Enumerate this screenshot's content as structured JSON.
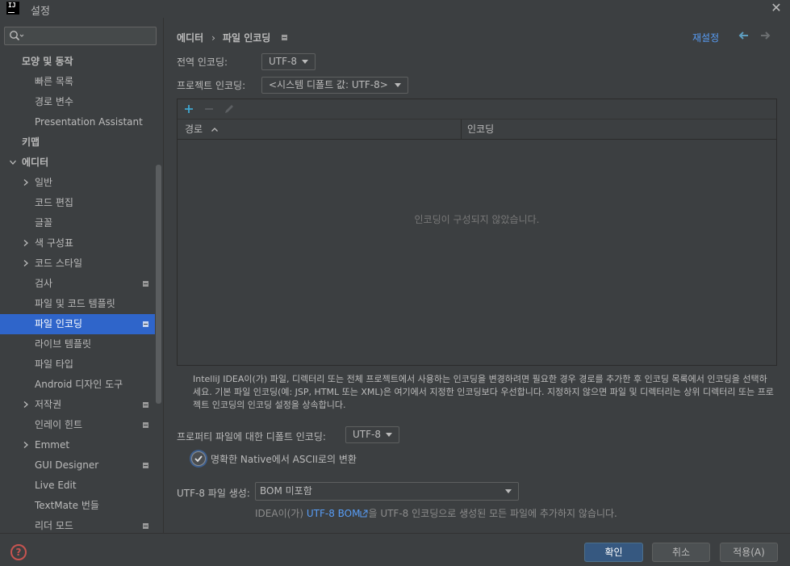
{
  "window": {
    "title": "설정",
    "logo_text": "IJ"
  },
  "sidebar": {
    "search_value": "",
    "items": [
      {
        "label": "모양 및 동작",
        "level": 0,
        "bold": true,
        "arrow": "none",
        "badge": false,
        "selected": false
      },
      {
        "label": "빠른 목록",
        "level": 1,
        "bold": false,
        "arrow": "none",
        "badge": false,
        "selected": false
      },
      {
        "label": "경로 변수",
        "level": 1,
        "bold": false,
        "arrow": "none",
        "badge": false,
        "selected": false
      },
      {
        "label": "Presentation Assistant",
        "level": 1,
        "bold": false,
        "arrow": "none",
        "badge": false,
        "selected": false
      },
      {
        "label": "키맵",
        "level": 0,
        "bold": true,
        "arrow": "none",
        "badge": false,
        "selected": false
      },
      {
        "label": "에디터",
        "level": 0,
        "bold": true,
        "arrow": "down",
        "badge": false,
        "selected": false
      },
      {
        "label": "일반",
        "level": 1,
        "bold": false,
        "arrow": "right",
        "badge": false,
        "selected": false
      },
      {
        "label": "코드 편집",
        "level": 1,
        "bold": false,
        "arrow": "none",
        "badge": false,
        "selected": false
      },
      {
        "label": "글꼴",
        "level": 1,
        "bold": false,
        "arrow": "none",
        "badge": false,
        "selected": false
      },
      {
        "label": "색 구성표",
        "level": 1,
        "bold": false,
        "arrow": "right",
        "badge": false,
        "selected": false
      },
      {
        "label": "코드 스타일",
        "level": 1,
        "bold": false,
        "arrow": "right",
        "badge": false,
        "selected": false
      },
      {
        "label": "검사",
        "level": 1,
        "bold": false,
        "arrow": "none",
        "badge": true,
        "selected": false
      },
      {
        "label": "파일 및 코드 템플릿",
        "level": 1,
        "bold": false,
        "arrow": "none",
        "badge": false,
        "selected": false
      },
      {
        "label": "파일 인코딩",
        "level": 1,
        "bold": false,
        "arrow": "none",
        "badge": true,
        "selected": true
      },
      {
        "label": "라이브 템플릿",
        "level": 1,
        "bold": false,
        "arrow": "none",
        "badge": false,
        "selected": false
      },
      {
        "label": "파일 타입",
        "level": 1,
        "bold": false,
        "arrow": "none",
        "badge": false,
        "selected": false
      },
      {
        "label": "Android 디자인 도구",
        "level": 1,
        "bold": false,
        "arrow": "none",
        "badge": false,
        "selected": false
      },
      {
        "label": "저작권",
        "level": 1,
        "bold": false,
        "arrow": "right",
        "badge": true,
        "selected": false
      },
      {
        "label": "인레이 힌트",
        "level": 1,
        "bold": false,
        "arrow": "none",
        "badge": true,
        "selected": false
      },
      {
        "label": "Emmet",
        "level": 1,
        "bold": false,
        "arrow": "right",
        "badge": false,
        "selected": false
      },
      {
        "label": "GUI Designer",
        "level": 1,
        "bold": false,
        "arrow": "none",
        "badge": true,
        "selected": false
      },
      {
        "label": "Live Edit",
        "level": 1,
        "bold": false,
        "arrow": "none",
        "badge": false,
        "selected": false
      },
      {
        "label": "TextMate 번들",
        "level": 1,
        "bold": false,
        "arrow": "none",
        "badge": false,
        "selected": false
      },
      {
        "label": "리더 모드",
        "level": 1,
        "bold": false,
        "arrow": "none",
        "badge": true,
        "selected": false
      }
    ]
  },
  "main": {
    "breadcrumb": [
      "에디터",
      "파일 인코딩"
    ],
    "breadcrumb_sep": "›",
    "reset_label": "재설정",
    "global_encoding_label": "전역 인코딩:",
    "global_encoding_value": "UTF-8",
    "project_encoding_label": "프로젝트 인코딩:",
    "project_encoding_value": "<시스템 디폴트 값: UTF-8>",
    "table": {
      "col_path": "경로",
      "col_encoding": "인코딩",
      "empty_text": "인코딩이 구성되지 않았습니다."
    },
    "description": "IntelliJ IDEA이(가) 파일, 디렉터리 또는 전체 프로젝트에서 사용하는 인코딩을 변경하려면 필요한 경우 경로를 추가한 후 인코딩 목록에서 인코딩을 선택하세요. 기본 파일 인코딩(예: JSP, HTML 또는 XML)은 여기에서 지정한 인코딩보다 우선합니다. 지정하지 않으면 파일 및 디렉터리는 상위 디렉터리 또는 프로젝트 인코딩의 인코딩 설정을 상속합니다.",
    "properties_label": "프로퍼티 파일에 대한 디폴트 인코딩:",
    "properties_value": "UTF-8",
    "native_ascii_label": "명확한 Native에서 ASCII로의 변환",
    "native_ascii_checked": true,
    "utf8_bom_label": "UTF-8 파일 생성:",
    "utf8_bom_value": "BOM 미포함",
    "hint_prefix": "IDEA이(가) ",
    "hint_link": "UTF-8 BOM",
    "hint_suffix": "을 UTF-8 인코딩으로 생성된 모든 파일에 추가하지 않습니다."
  },
  "footer": {
    "help_label": "?",
    "ok_label": "확인",
    "cancel_label": "취소",
    "apply_label": "적용(A)"
  },
  "colors": {
    "background": "#3c3f41",
    "selection": "#2f65ca",
    "link": "#589df6",
    "primary_button": "#365880",
    "help": "#c75450"
  }
}
